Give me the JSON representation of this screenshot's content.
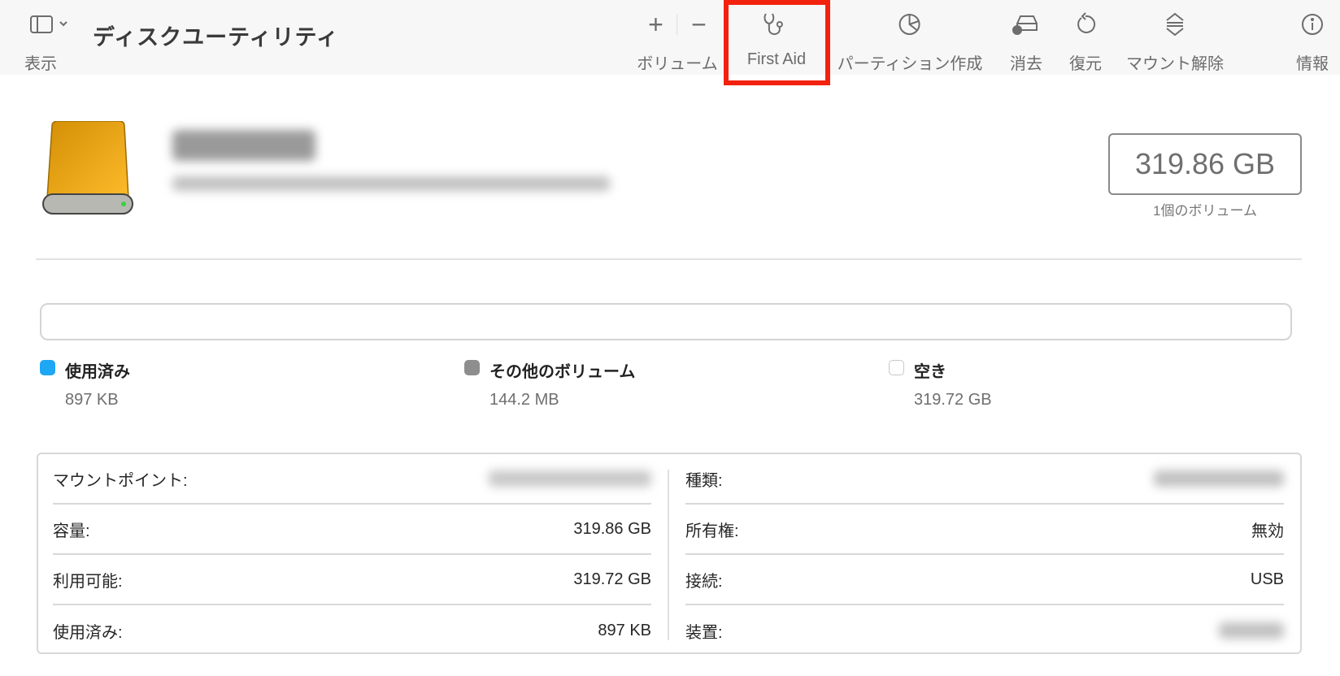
{
  "toolbar": {
    "view_label": "表示",
    "title": "ディスクユーティリティ",
    "buttons": [
      {
        "id": "volume",
        "label": "ボリューム",
        "icon": "plus-minus-icon"
      },
      {
        "id": "first-aid",
        "label": "First Aid",
        "icon": "stethoscope-icon",
        "highlighted": true
      },
      {
        "id": "partition",
        "label": "パーティション作成",
        "icon": "pie-chart-icon"
      },
      {
        "id": "erase",
        "label": "消去",
        "icon": "erase-drive-icon"
      },
      {
        "id": "restore",
        "label": "復元",
        "icon": "restore-icon"
      },
      {
        "id": "unmount",
        "label": "マウント解除",
        "icon": "unmount-icon"
      },
      {
        "id": "info",
        "label": "情報",
        "icon": "info-icon"
      }
    ],
    "highlight_color": "#f2220f"
  },
  "disk": {
    "capacity": "319.86 GB",
    "volume_count": "1個のボリューム"
  },
  "usage": {
    "legend": [
      {
        "name": "使用済み",
        "value": "897 KB",
        "color": "#1ea7f5"
      },
      {
        "name": "その他のボリューム",
        "value": "144.2 MB",
        "color": "#8e8e8e"
      },
      {
        "name": "空き",
        "value": "319.72 GB",
        "color": "#ffffff"
      }
    ]
  },
  "details": {
    "left": [
      {
        "label": "マウントポイント:",
        "value": null
      },
      {
        "label": "容量:",
        "value": "319.86 GB"
      },
      {
        "label": "利用可能:",
        "value": "319.72 GB"
      },
      {
        "label": "使用済み:",
        "value": "897 KB"
      }
    ],
    "right": [
      {
        "label": "種類:",
        "value": null
      },
      {
        "label": "所有権:",
        "value": "無効"
      },
      {
        "label": "接続:",
        "value": "USB"
      },
      {
        "label": "装置:",
        "value": null
      }
    ]
  }
}
